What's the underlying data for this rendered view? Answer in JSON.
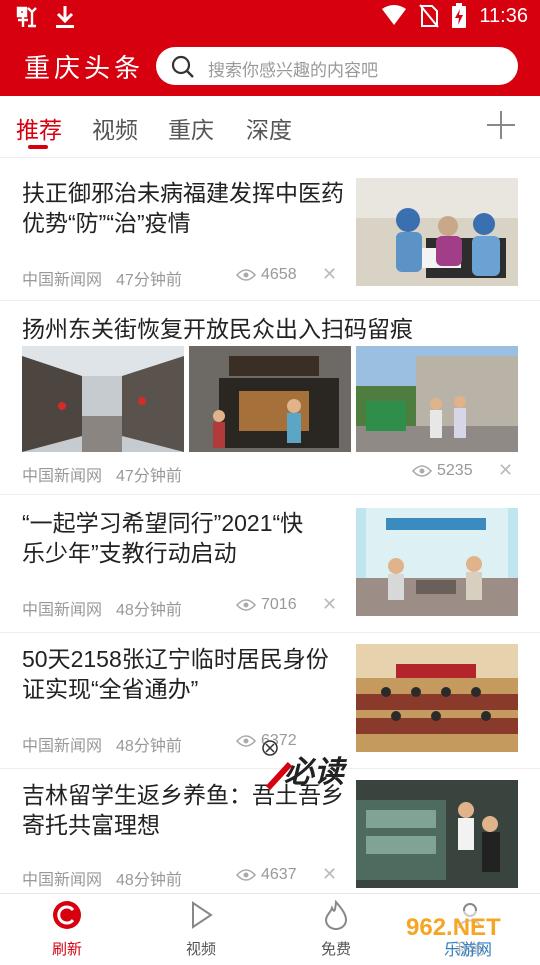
{
  "status_bar": {
    "time": "11:36"
  },
  "header": {
    "title": "重庆头条",
    "search_placeholder": "搜索你感兴趣的内容吧"
  },
  "tabs": [
    {
      "label": "推荐",
      "active": true
    },
    {
      "label": "视频"
    },
    {
      "label": "重庆"
    },
    {
      "label": "深度"
    }
  ],
  "news": [
    {
      "title_line1": "扶正御邪治未病福建发挥中医药",
      "title_line2": "优势“防”“治”疫情",
      "source": "中国新闻网",
      "time": "47分钟前",
      "views": "4658"
    },
    {
      "title_line1": "扬州东关街恢复开放民众出入扫码留痕",
      "source": "中国新闻网",
      "time": "47分钟前",
      "views": "5235"
    },
    {
      "title_line1": "“一起学习希望同行”2021“快",
      "title_line2": "乐少年”支教行动启动",
      "source": "中国新闻网",
      "time": "48分钟前",
      "views": "7016"
    },
    {
      "title_line1": "50天2158张辽宁临时居民身份",
      "title_line2": "证实现“全省通办”",
      "source": "中国新闻网",
      "time": "48分钟前",
      "views": "6372"
    },
    {
      "title_line1": "吉林留学生返乡养鱼：吾土吾乡",
      "title_line2": "寄托共富理想",
      "source": "中国新闻网",
      "time": "48分钟前",
      "views": "4637"
    }
  ],
  "bottom_nav": [
    {
      "label": "刷新",
      "active": true
    },
    {
      "label": "视频"
    },
    {
      "label": "免费"
    },
    {
      "label": "我的"
    }
  ],
  "overlay_logo_text": "必读",
  "watermark": {
    "brand": "962.NET",
    "subtitle": "乐游网"
  },
  "colors": {
    "brand_red": "#d7000f"
  }
}
